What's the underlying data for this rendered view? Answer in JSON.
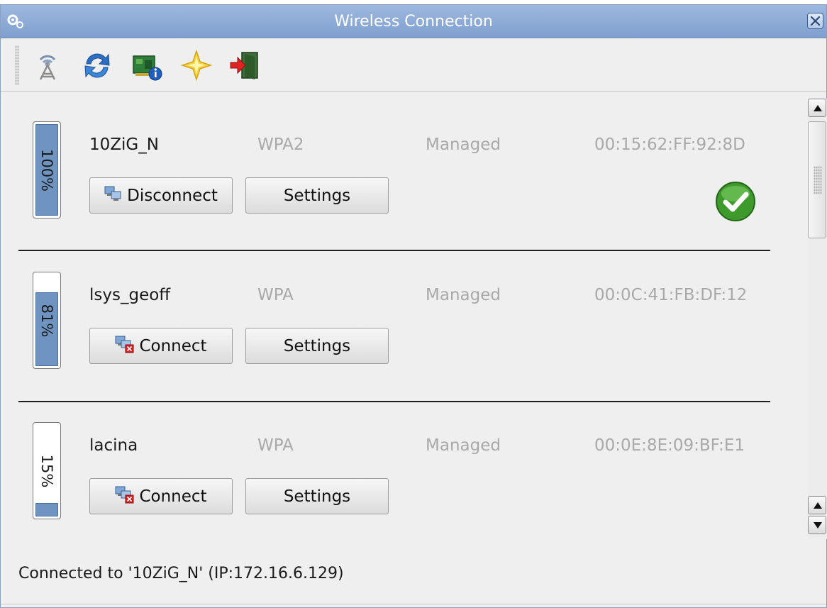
{
  "window": {
    "title": "Wireless Connection"
  },
  "toolbar": {
    "items": [
      {
        "name": "wireless-tower-icon"
      },
      {
        "name": "refresh-icon"
      },
      {
        "name": "network-card-info-icon"
      },
      {
        "name": "star-icon"
      },
      {
        "name": "exit-icon"
      }
    ]
  },
  "networks": [
    {
      "ssid": "10ZiG_N",
      "encryption": "WPA2",
      "mode": "Managed",
      "mac": "00:15:62:FF:92:8D",
      "signal_label": "100%",
      "signal_fraction": 1.0,
      "action_label": "Disconnect",
      "settings_label": "Settings",
      "connected": true
    },
    {
      "ssid": "lsys_geoff",
      "encryption": "WPA",
      "mode": "Managed",
      "mac": "00:0C:41:FB:DF:12",
      "signal_label": "81%",
      "signal_fraction": 0.81,
      "action_label": "Connect",
      "settings_label": "Settings",
      "connected": false
    },
    {
      "ssid": "lacina",
      "encryption": "WPA",
      "mode": "Managed",
      "mac": "00:0E:8E:09:BF:E1",
      "signal_label": "15%",
      "signal_fraction": 0.15,
      "action_label": "Connect",
      "settings_label": "Settings",
      "connected": false
    }
  ],
  "status": {
    "text": "Connected to '10ZiG_N' (IP:172.16.6.129)"
  },
  "colors": {
    "titlebar": "#8fadd8",
    "signal_fill": "#6f94c2",
    "connected_check": "#3d9a2b"
  }
}
